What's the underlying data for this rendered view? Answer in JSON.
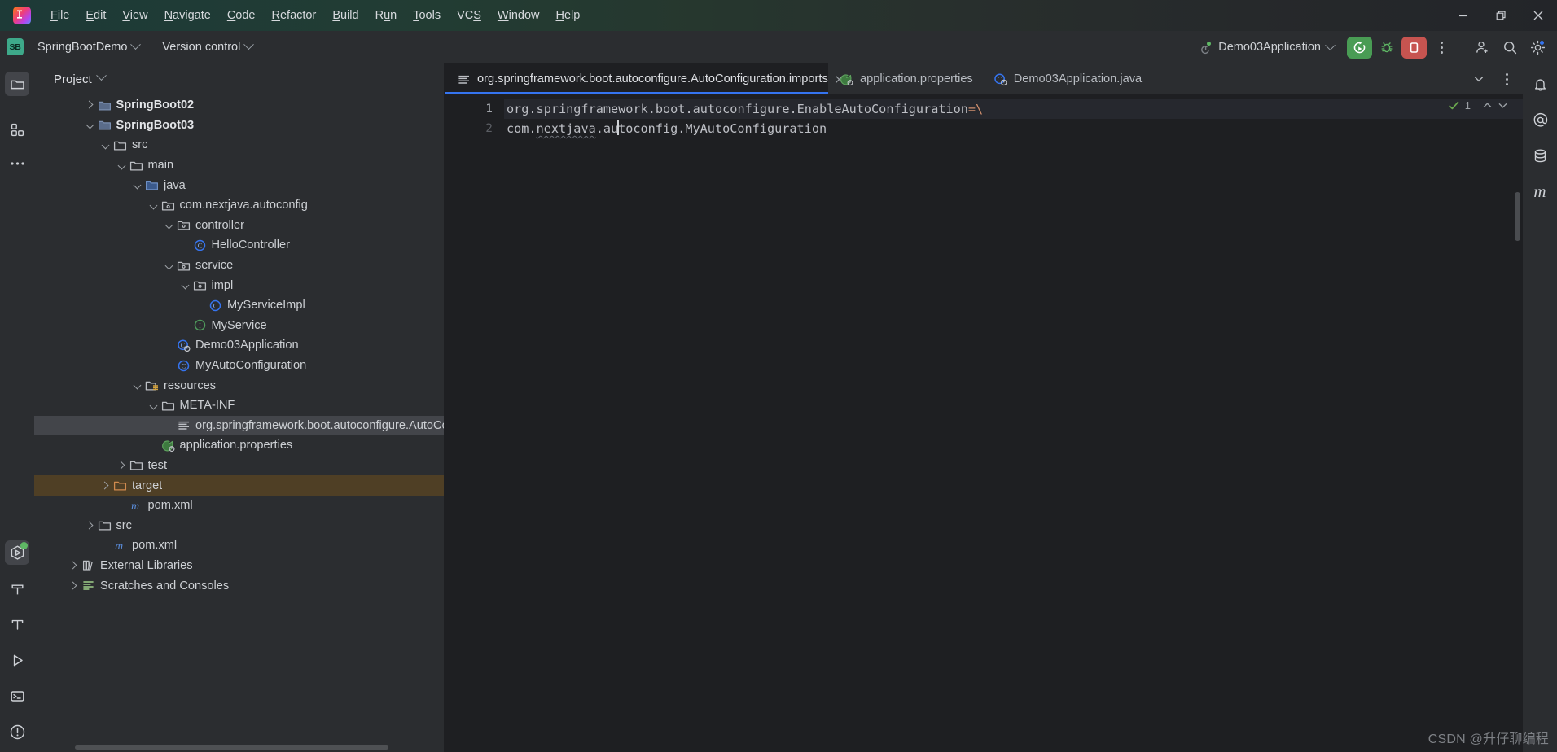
{
  "window": {
    "minimize_label": "Minimize",
    "restore_label": "Restore",
    "close_label": "Close"
  },
  "menubar": {
    "logo": "intellij-idea-logo",
    "items": [
      {
        "label": "File",
        "mnemonic": "F"
      },
      {
        "label": "Edit",
        "mnemonic": "E"
      },
      {
        "label": "View",
        "mnemonic": "V"
      },
      {
        "label": "Navigate",
        "mnemonic": "N"
      },
      {
        "label": "Code",
        "mnemonic": "C"
      },
      {
        "label": "Refactor",
        "mnemonic": "R"
      },
      {
        "label": "Build",
        "mnemonic": "B"
      },
      {
        "label": "Run",
        "mnemonic": "n"
      },
      {
        "label": "Tools",
        "mnemonic": "T"
      },
      {
        "label": "VCS",
        "mnemonic": "S"
      },
      {
        "label": "Window",
        "mnemonic": "W"
      },
      {
        "label": "Help",
        "mnemonic": "H"
      }
    ]
  },
  "toolbar": {
    "project_badge": "SB",
    "project_name": "SpringBootDemo",
    "version_control": "Version control",
    "run_config": "Demo03Application",
    "run_button": "run-button",
    "debug_button": "debug-button",
    "stop_button": "stop-button",
    "more_button": "more-actions",
    "account_button": "account",
    "search_button": "search-everywhere",
    "settings_button": "settings",
    "accent_run": "#499c54",
    "accent_stop": "#c75450",
    "accent_blue": "#3574f0"
  },
  "rail_left": {
    "items": [
      {
        "name": "project-tool-window",
        "icon": "folder-icon",
        "selected": true
      },
      {
        "name": "commit-tool-window",
        "icon": "structure-icon",
        "selected": false
      },
      {
        "name": "more-tool-windows",
        "icon": "more-dots-icon",
        "selected": false
      }
    ],
    "bottom_items": [
      {
        "name": "run-tool-window",
        "icon": "run-hexagon-icon",
        "selected": true,
        "badge": "green"
      },
      {
        "name": "build-tool-window",
        "icon": "hammer-icon",
        "selected": false
      },
      {
        "name": "structure-tool-window",
        "icon": "structure-t-icon",
        "selected": false
      },
      {
        "name": "services-tool-window",
        "icon": "play-icon",
        "selected": false
      },
      {
        "name": "terminal-tool-window",
        "icon": "terminal-icon",
        "selected": false
      },
      {
        "name": "problems-tool-window",
        "icon": "warning-icon",
        "selected": false
      }
    ]
  },
  "rail_right": {
    "items": [
      {
        "name": "notifications",
        "icon": "bell-icon"
      },
      {
        "name": "ai-assistant",
        "icon": "at-icon"
      },
      {
        "name": "database",
        "icon": "database-icon"
      },
      {
        "name": "maven",
        "icon": "maven-m-icon"
      }
    ]
  },
  "project_panel": {
    "title": "Project",
    "tree": [
      {
        "depth": 1,
        "arrow": "right",
        "icon": "module-icon",
        "label": "SpringBoot02",
        "bold": true,
        "state": "none"
      },
      {
        "depth": 1,
        "arrow": "down",
        "icon": "module-icon",
        "label": "SpringBoot03",
        "bold": true,
        "state": "none"
      },
      {
        "depth": 2,
        "arrow": "down",
        "icon": "folder-icon",
        "label": "src",
        "bold": false,
        "state": "none"
      },
      {
        "depth": 3,
        "arrow": "down",
        "icon": "folder-icon",
        "label": "main",
        "bold": false,
        "state": "none"
      },
      {
        "depth": 4,
        "arrow": "down",
        "icon": "source-root-icon",
        "label": "java",
        "bold": false,
        "state": "none"
      },
      {
        "depth": 5,
        "arrow": "down",
        "icon": "package-icon",
        "label": "com.nextjava.autoconfig",
        "bold": false,
        "state": "none"
      },
      {
        "depth": 6,
        "arrow": "down",
        "icon": "package-icon",
        "label": "controller",
        "bold": false,
        "state": "none"
      },
      {
        "depth": 7,
        "arrow": "none",
        "icon": "class-icon",
        "label": "HelloController",
        "bold": false,
        "state": "none"
      },
      {
        "depth": 6,
        "arrow": "down",
        "icon": "package-icon",
        "label": "service",
        "bold": false,
        "state": "none"
      },
      {
        "depth": 7,
        "arrow": "down",
        "icon": "package-icon",
        "label": "impl",
        "bold": false,
        "state": "none"
      },
      {
        "depth": 8,
        "arrow": "none",
        "icon": "class-icon",
        "label": "MyServiceImpl",
        "bold": false,
        "state": "none"
      },
      {
        "depth": 7,
        "arrow": "none",
        "icon": "interface-icon",
        "label": "MyService",
        "bold": false,
        "state": "none"
      },
      {
        "depth": 6,
        "arrow": "none",
        "icon": "springboot-class-icon",
        "label": "Demo03Application",
        "bold": false,
        "state": "none"
      },
      {
        "depth": 6,
        "arrow": "none",
        "icon": "class-icon",
        "label": "MyAutoConfiguration",
        "bold": false,
        "state": "none"
      },
      {
        "depth": 4,
        "arrow": "down",
        "icon": "resources-icon",
        "label": "resources",
        "bold": false,
        "state": "none"
      },
      {
        "depth": 5,
        "arrow": "down",
        "icon": "folder-icon",
        "label": "META-INF",
        "bold": false,
        "state": "none"
      },
      {
        "depth": 6,
        "arrow": "none",
        "icon": "text-file-icon",
        "label": "org.springframework.boot.autoconfigure.AutoConfig",
        "bold": false,
        "state": "selected"
      },
      {
        "depth": 5,
        "arrow": "none",
        "icon": "spring-properties-icon",
        "label": "application.properties",
        "bold": false,
        "state": "none"
      },
      {
        "depth": 3,
        "arrow": "right",
        "icon": "folder-icon",
        "label": "test",
        "bold": false,
        "state": "none"
      },
      {
        "depth": 2,
        "arrow": "right",
        "icon": "target-folder-icon",
        "label": "target",
        "bold": false,
        "state": "target"
      },
      {
        "depth": 3,
        "arrow": "none",
        "icon": "maven-m-icon",
        "label": "pom.xml",
        "bold": false,
        "state": "none"
      },
      {
        "depth": 1,
        "arrow": "right",
        "icon": "folder-icon",
        "label": "src",
        "bold": false,
        "state": "none"
      },
      {
        "depth": 2,
        "arrow": "none",
        "icon": "maven-m-icon",
        "label": "pom.xml",
        "bold": false,
        "state": "none"
      },
      {
        "depth": 0,
        "arrow": "right",
        "icon": "libraries-icon",
        "label": "External Libraries",
        "bold": false,
        "state": "none"
      },
      {
        "depth": 0,
        "arrow": "right",
        "icon": "scratches-icon",
        "label": "Scratches and Consoles",
        "bold": false,
        "state": "none"
      }
    ]
  },
  "editor": {
    "tabs": [
      {
        "label": "org.springframework.boot.autoconfigure.AutoConfiguration.imports",
        "icon": "text-file-icon",
        "active": true,
        "closable": true
      },
      {
        "label": "application.properties",
        "icon": "spring-properties-icon",
        "active": false,
        "closable": false
      },
      {
        "label": "Demo03Application.java",
        "icon": "springboot-class-icon",
        "active": false,
        "closable": false
      }
    ],
    "tab_actions": {
      "chevron": "chevron-down-icon",
      "more": "more-actions-icon"
    },
    "inspection": {
      "status": "ok",
      "count": "1",
      "up": "previous-highlight",
      "down": "next-highlight"
    },
    "lines": [
      {
        "num": "1",
        "current": true,
        "text": "org.springframework.boot.autoconfigure.EnableAutoConfiguration",
        "suffix": "=\\"
      },
      {
        "num": "2",
        "current": false,
        "text": "com.",
        "mid": "nextjava",
        "tail": ".autoconfig.MyAutoConfiguration"
      }
    ]
  },
  "watermark": "CSDN @升仔聊编程"
}
